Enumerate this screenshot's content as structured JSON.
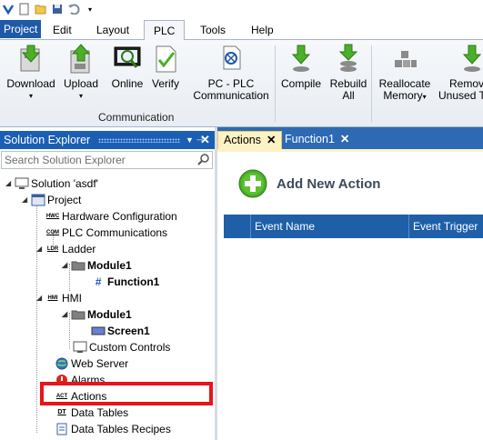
{
  "quick_access": {
    "icons": [
      "app-icon",
      "new-file-icon",
      "open-folder-icon",
      "save-icon",
      "undo-icon",
      "dropdown-arrow-icon"
    ]
  },
  "menu": {
    "tabs": [
      {
        "label": "Project"
      },
      {
        "label": "Edit"
      },
      {
        "label": "Layout"
      },
      {
        "label": "PLC"
      },
      {
        "label": "Tools"
      },
      {
        "label": "Help"
      }
    ]
  },
  "ribbon": {
    "download": "Download",
    "upload": "Upload",
    "online": "Online",
    "verify": "Verify",
    "pc_plc_line1": "PC - PLC",
    "pc_plc_line2": "Communication",
    "compile": "Compile",
    "rebuild_line1": "Rebuild",
    "rebuild_line2": "All",
    "reallocate_line1": "Reallocate",
    "reallocate_line2": "Memory",
    "remove_line1": "Remov",
    "remove_line2": "Unused T",
    "group_communication": "Communication"
  },
  "solution_explorer": {
    "title": "Solution Explorer",
    "search_placeholder": "Search Solution Explorer",
    "tree": {
      "solution": "Solution 'asdf'",
      "project": "Project",
      "hardware": "Hardware Configuration",
      "plc_comm": "PLC Communications",
      "ladder": "Ladder",
      "module1": "Module1",
      "function1": "Function1",
      "hmi": "HMI",
      "hmi_module1": "Module1",
      "screen1": "Screen1",
      "custom_controls": "Custom Controls",
      "web_server": "Web Server",
      "alarms": "Alarms",
      "actions": "Actions",
      "data_tables": "Data Tables",
      "data_tables_recipes": "Data Tables Recipes"
    },
    "icon_badges": {
      "hwc": "HWC",
      "com": "COM",
      "ldr": "LDR",
      "hmi": "HMI",
      "act": "ACT",
      "dt": "DT"
    }
  },
  "documents": {
    "tabs": [
      {
        "label": "Actions",
        "close": "✕"
      },
      {
        "label": "Function1",
        "close": "✕"
      }
    ]
  },
  "actions_view": {
    "add_label": "Add New Action",
    "columns": [
      "Event Name",
      "Event Trigger"
    ]
  },
  "colors": {
    "accent": "#1e5aa8",
    "highlight": "#e8141b",
    "add_green": "#4caf2a"
  }
}
